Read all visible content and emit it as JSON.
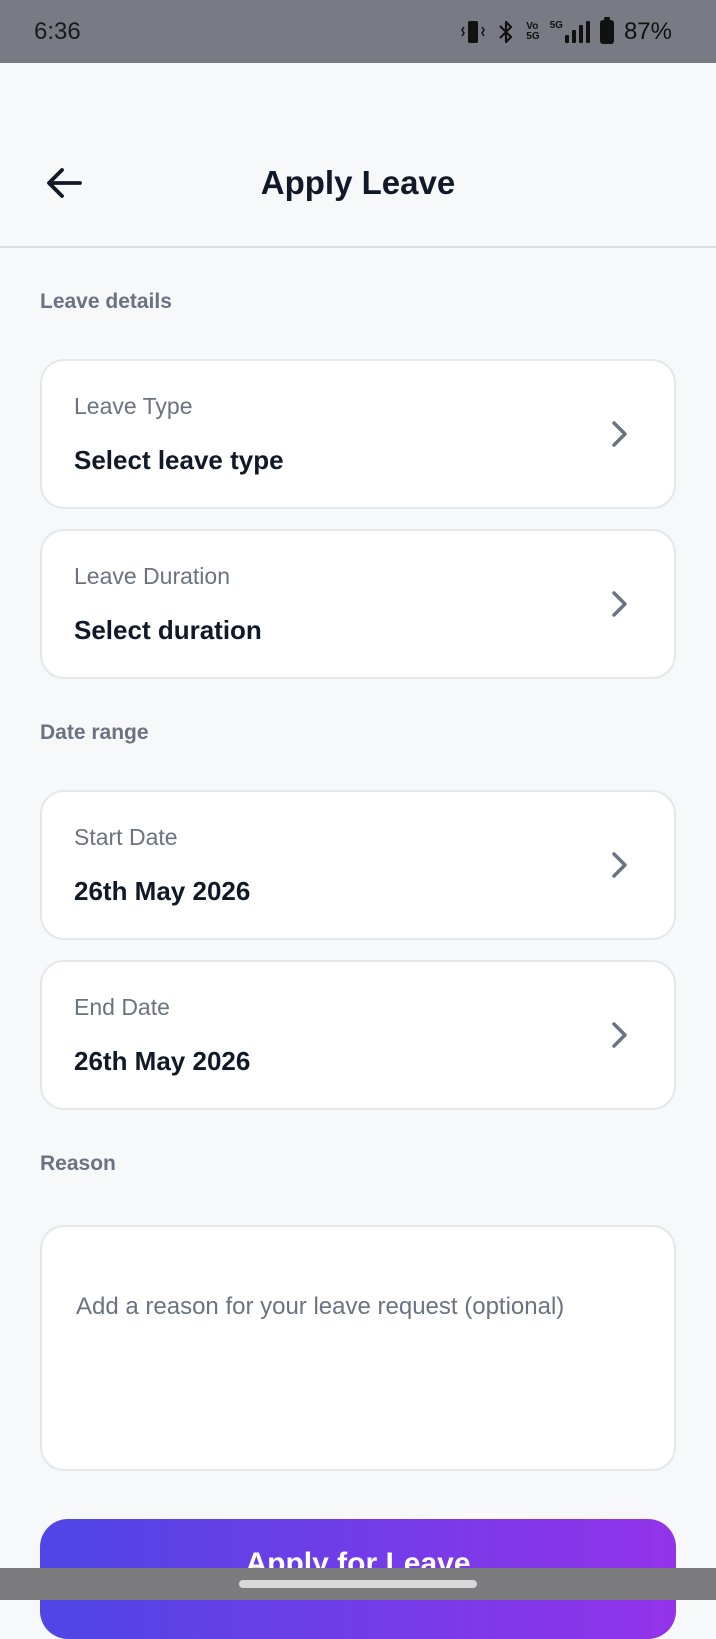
{
  "status_bar": {
    "time": "6:36",
    "network_vo": "Vo\n5G",
    "network_5g": "5G",
    "battery_percent": "87%",
    "icons": [
      "vibrate-icon",
      "bluetooth-icon",
      "volte-icon",
      "signal-icon",
      "battery-icon"
    ]
  },
  "header": {
    "title": "Apply Leave",
    "back_icon": "arrow-left-icon"
  },
  "sections": {
    "leave_details": "Leave details",
    "date_range": "Date range",
    "reason": "Reason"
  },
  "fields": {
    "leave_type": {
      "label": "Leave Type",
      "value": "Select leave type"
    },
    "leave_duration": {
      "label": "Leave Duration",
      "value": "Select duration"
    },
    "start_date": {
      "label": "Start Date",
      "value": "26th May 2026"
    },
    "end_date": {
      "label": "End Date",
      "value": "26th May 2026"
    }
  },
  "reason_input": {
    "value": "",
    "placeholder": "Add a reason for your leave request (optional)"
  },
  "apply_button": {
    "label": "Apply for Leave"
  },
  "colors": {
    "accent_start": "#4f46e5",
    "accent_end": "#9333ea",
    "title_text": "#111827",
    "muted_text": "#6b7280"
  }
}
